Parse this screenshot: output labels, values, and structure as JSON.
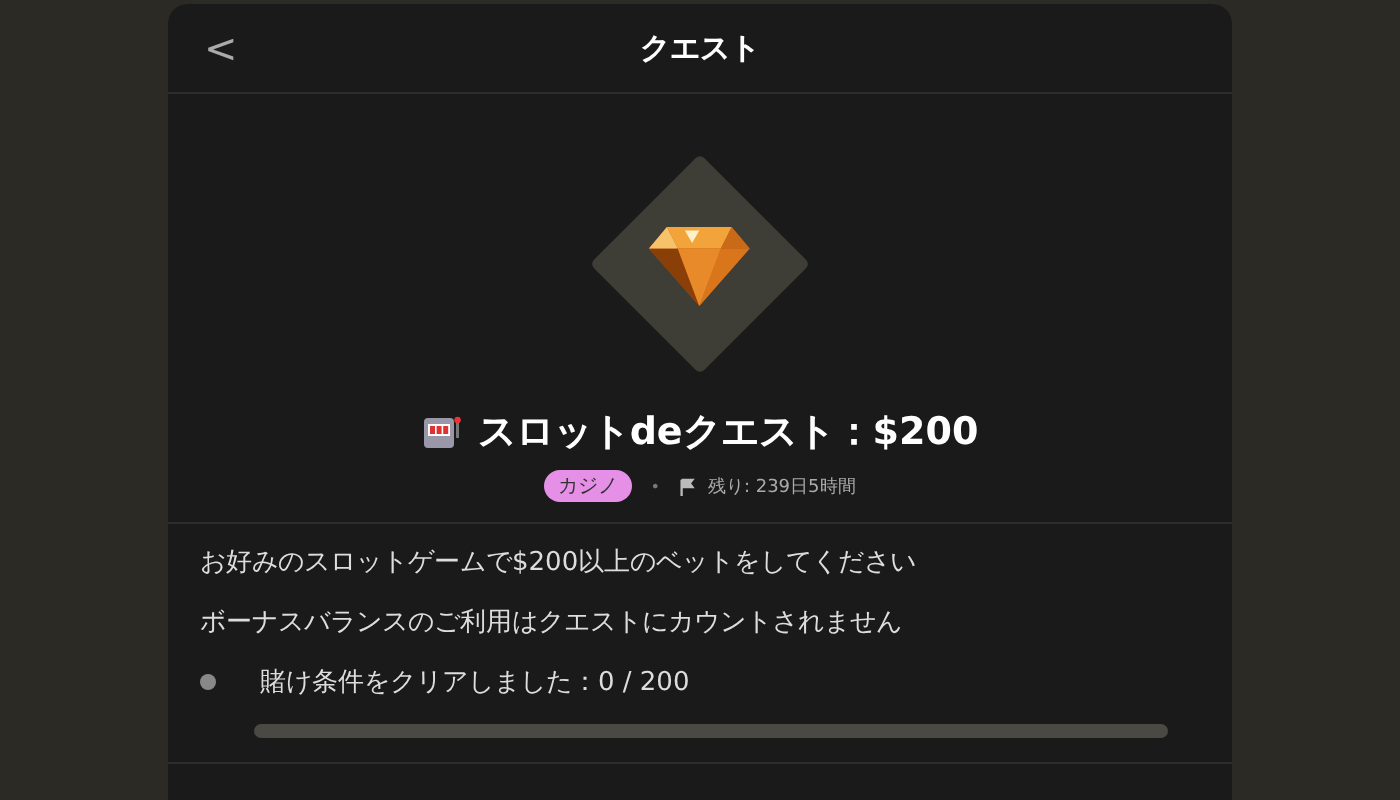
{
  "header": {
    "back": "<",
    "title": "クエスト"
  },
  "quest": {
    "title": "スロットdeクエスト：$200",
    "tag": {
      "label": "カジノ",
      "color": "#e58fe6"
    },
    "separator": "•",
    "remaining": "残り: 239日5時間"
  },
  "descriptions": [
    "お好みのスロットゲームで$200以上のベットをしてください",
    "ボーナスバランスのご利用はクエストにカウントされません"
  ],
  "progress": {
    "label": "賭け条件をクリアしました：0 / 200",
    "done": false,
    "level": 0
  }
}
